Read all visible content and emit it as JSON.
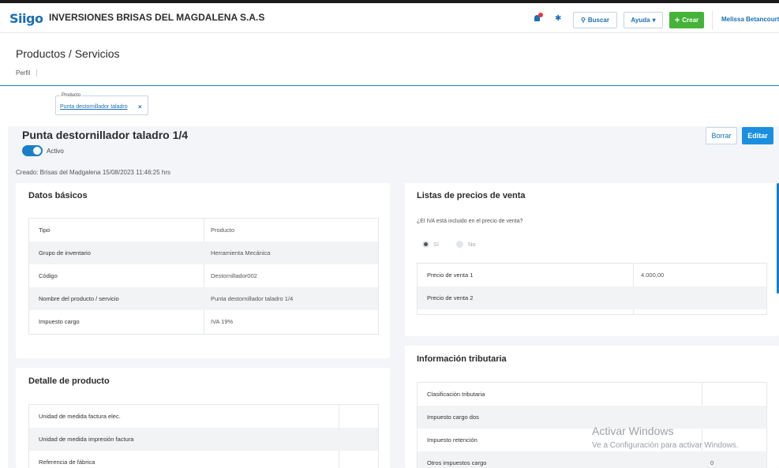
{
  "header": {
    "logo": "Siigo",
    "company": "INVERSIONES BRISAS DEL MAGDALENA S.A.S",
    "search_label": "Buscar",
    "help_label": "Ayuda",
    "create_label": "Crear",
    "user_name": "Melissa Betancourt"
  },
  "page": {
    "title": "Productos / Servicios",
    "tab_profile": "Perfil"
  },
  "filter": {
    "label": "Producto",
    "value": "Punta destornillador taladro",
    "clear": "×"
  },
  "product": {
    "title": "Punta destornillador taladro 1/4",
    "status_label": "Activo",
    "status_on": true,
    "created": "Creado: Brisas del Madgalena 15/08/2023 11:46:25 hrs",
    "delete_label": "Borrar",
    "edit_label": "Editar"
  },
  "datos_basicos": {
    "title": "Datos básicos",
    "rows": [
      {
        "label": "Tipo",
        "value": "Producto"
      },
      {
        "label": "Grupo de inventario",
        "value": "Herramienta Mecánica"
      },
      {
        "label": "Código",
        "value": "Destornillador002"
      },
      {
        "label": "Nombre del producto / servicio",
        "value": "Punta destornillador taladro 1/4"
      },
      {
        "label": "Impuesto cargo",
        "value": "IVA 19%"
      }
    ]
  },
  "detalle_producto": {
    "title": "Detalle de producto",
    "rows": [
      {
        "label": "Unidad de medida factura elec.",
        "value": ""
      },
      {
        "label": "Unidad de medida impresión factura",
        "value": ""
      },
      {
        "label": "Referencia de fábrica",
        "value": ""
      }
    ]
  },
  "listas_precios": {
    "title": "Listas de precios de venta",
    "question": "¿El IVA está incluido en el precio de venta?",
    "option_yes": "Sí",
    "option_no": "No",
    "rows": [
      {
        "label": "Precio de venta 1",
        "value": "4.000,00"
      },
      {
        "label": "Precio de venta 2",
        "value": ""
      }
    ]
  },
  "informacion_tributaria": {
    "title": "Información tributaria",
    "rows": [
      {
        "label": "Clasificación tributaria",
        "value": ""
      },
      {
        "label": "Impuesto cargo dos",
        "value": ""
      },
      {
        "label": "Impuesto retención",
        "value": ""
      },
      {
        "label": "Otros impuestos cargo",
        "value": "0"
      }
    ]
  },
  "watermark": {
    "line1": "Activar Windows",
    "line2": "Ve a Configuración para activar Windows."
  },
  "colors": {
    "brand_blue": "#1a6fb5",
    "create_green": "#45b339",
    "edit_blue": "#1a8fe0"
  }
}
